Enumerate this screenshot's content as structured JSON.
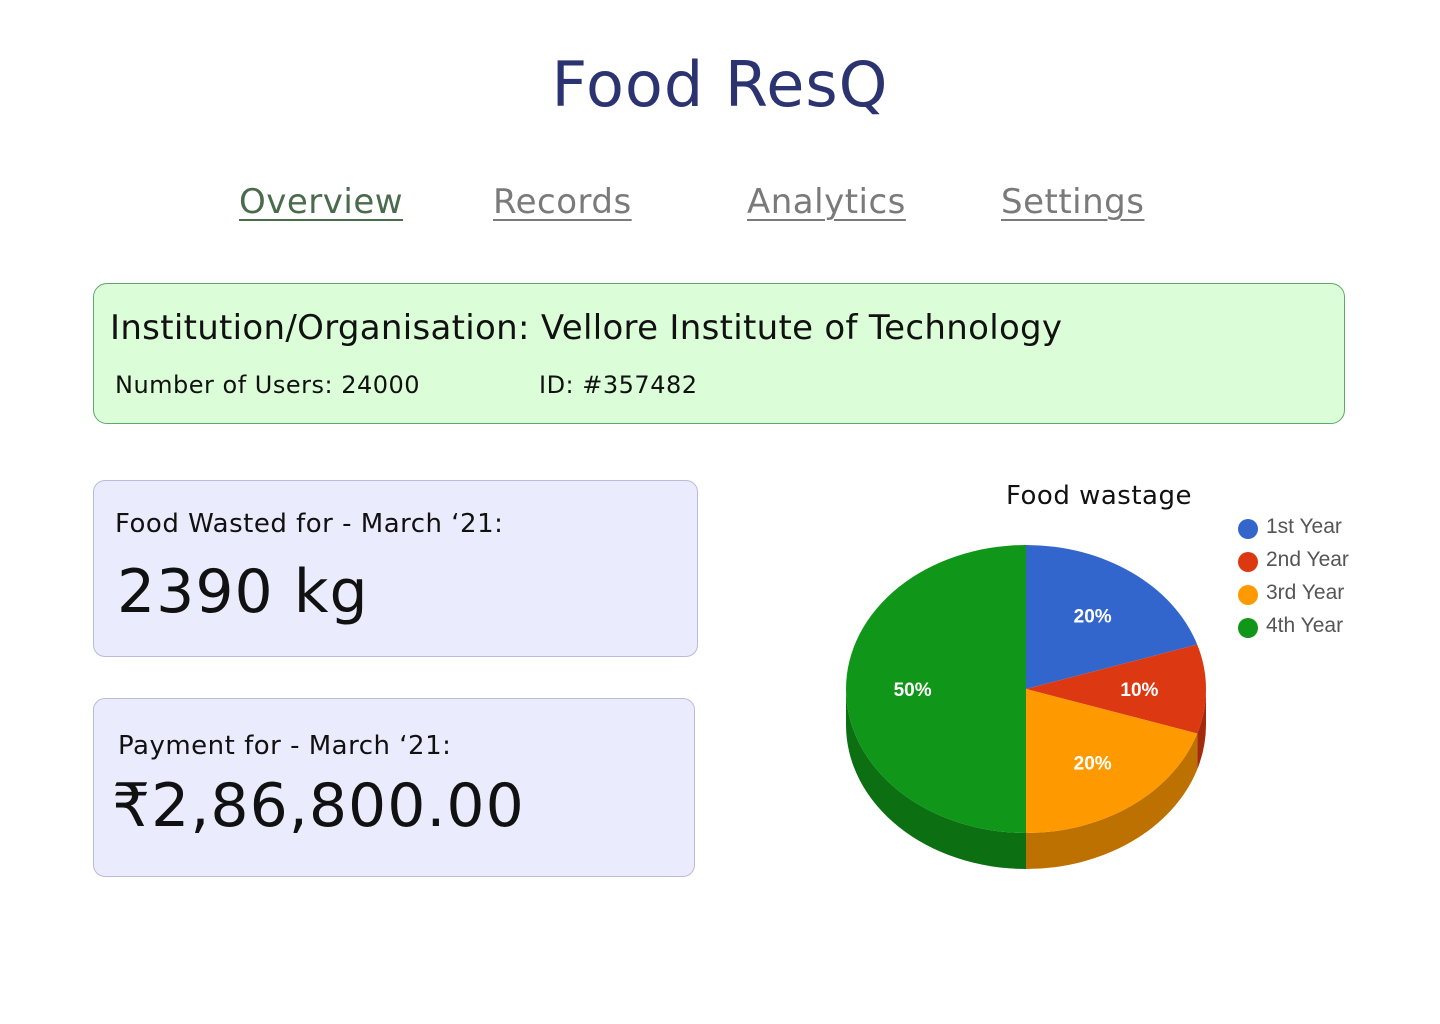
{
  "app": {
    "title": "Food ResQ"
  },
  "nav": {
    "tabs": [
      {
        "label": "Overview",
        "active": true
      },
      {
        "label": "Records",
        "active": false
      },
      {
        "label": "Analytics",
        "active": false
      },
      {
        "label": "Settings",
        "active": false
      }
    ]
  },
  "organisation": {
    "name_line": "Institution/Organisation: Vellore Institute of Technology",
    "users_line": "Number of Users: 24000",
    "id_line": "ID: #357482"
  },
  "food_wasted": {
    "label": "Food Wasted for - March ‘21:",
    "value": "2390 kg"
  },
  "payment": {
    "label": "Payment for - March ‘21:",
    "value": "₹2,86,800.00"
  },
  "colors": {
    "title": "#2b3470",
    "org_card_bg": "#dbfdd7",
    "stat_card_bg": "#eaecfd"
  },
  "chart_data": {
    "type": "pie",
    "title": "Food wastage",
    "style": "3d",
    "legend": "right",
    "categories": [
      "1st Year",
      "2nd Year",
      "3rd Year",
      "4th Year"
    ],
    "values": [
      20,
      10,
      20,
      50
    ],
    "labels": [
      "20%",
      "10%",
      "20%",
      "50%"
    ],
    "colors": [
      "#3366cc",
      "#dc3912",
      "#ff9900",
      "#109618"
    ]
  }
}
